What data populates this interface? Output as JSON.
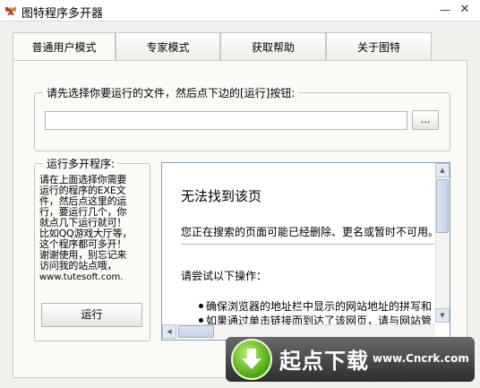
{
  "window": {
    "title": "图特程序多开器",
    "minimize_glyph": "—",
    "close_glyph": "✕"
  },
  "tabs": [
    {
      "label": "普通用户模式",
      "active": true
    },
    {
      "label": "专家模式",
      "active": false
    },
    {
      "label": "获取帮助",
      "active": false
    },
    {
      "label": "关于图特",
      "active": false
    }
  ],
  "file_group": {
    "label": "请先选择你要运行的文件，然后点下边的[运行]按钮:",
    "input_value": "",
    "browse_label": "..."
  },
  "run_group": {
    "label": "运行多开程序:",
    "description": "请在上面选择你需要\n运行的程序的EXE文\n件，然后点这里的运\n行，要运行几个，你\n就点几下运行就可！\n比如QQ游戏大厅等，\n这个程序都可多开！\n谢谢使用，别忘记来\n访问我的站点哦，",
    "url": "www.tutesoft.com.",
    "run_label": "运行"
  },
  "browser": {
    "heading": "无法找到该页",
    "line1": "您正在搜索的页面可能已经删除、更名或暂时不可用。",
    "try_text": "请尝试以下操作：",
    "bullets": [
      "确保浏览器的地址栏中显示的网站地址的拼写和",
      "如果通过单击链接而到达了该网页，请与网站管"
    ]
  },
  "watermark": {
    "title": "起点下载",
    "url": "www.Cncrk.com"
  },
  "colors": {
    "accent_green": "#4aa414",
    "border_blue": "#7f9db9"
  },
  "icons": {
    "app": "butterfly-icon",
    "download": "download-arrow-icon"
  }
}
